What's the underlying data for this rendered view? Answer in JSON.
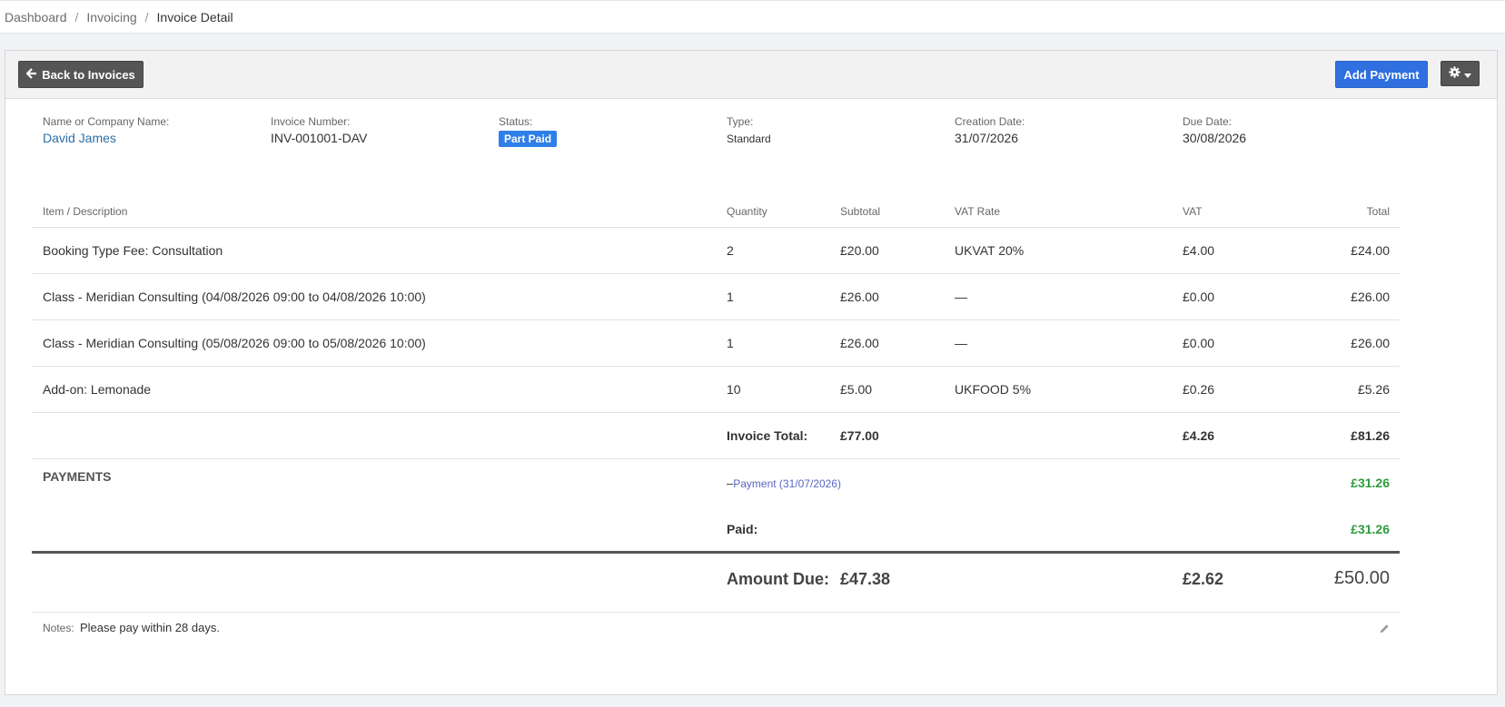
{
  "breadcrumb": {
    "items": [
      "Dashboard",
      "Invoicing"
    ],
    "current": "Invoice Detail",
    "separator": "/"
  },
  "toolbar": {
    "back_label": "Back to Invoices",
    "add_payment_label": "Add Payment"
  },
  "info": {
    "name_label": "Name or Company Name:",
    "name_value": "David James",
    "number_label": "Invoice Number:",
    "number_value": "INV-001001-DAV",
    "status_label": "Status:",
    "status_value": "Part Paid",
    "type_label": "Type:",
    "type_value": "Standard",
    "creation_label": "Creation Date:",
    "creation_value": "31/07/2026",
    "due_label": "Due Date:",
    "due_value": "30/08/2026"
  },
  "table": {
    "headers": [
      "Item / Description",
      "Quantity",
      "Subtotal",
      "VAT Rate",
      "VAT",
      "Total"
    ],
    "rows": [
      {
        "description": "Booking Type Fee: Consultation",
        "quantity": "2",
        "subtotal": "£20.00",
        "vat_rate": "UKVAT 20%",
        "vat": "£4.00",
        "total": "£24.00"
      },
      {
        "description": "Class - Meridian Consulting (04/08/2026 09:00 to 04/08/2026 10:00)",
        "quantity": "1",
        "subtotal": "£26.00",
        "vat_rate": "—",
        "vat": "£0.00",
        "total": "£26.00"
      },
      {
        "description": "Class - Meridian Consulting (05/08/2026 09:00 to 05/08/2026 10:00)",
        "quantity": "1",
        "subtotal": "£26.00",
        "vat_rate": "—",
        "vat": "£0.00",
        "total": "£26.00"
      },
      {
        "description": "Add-on: Lemonade",
        "quantity": "10",
        "subtotal": "£5.00",
        "vat_rate": "UKFOOD 5%",
        "vat": "£0.26",
        "total": "£5.26"
      }
    ],
    "invoice_total": {
      "label": "Invoice Total:",
      "subtotal": "£77.00",
      "vat": "£4.26",
      "total": "£81.26"
    }
  },
  "payments": {
    "heading": "PAYMENTS",
    "item_prefix": "–",
    "item_label": "Payment (31/07/2026)",
    "item_amount": "£31.26",
    "paid_label": "Paid:",
    "paid_amount": "£31.26"
  },
  "amount_due": {
    "label": "Amount Due:",
    "subtotal": "£47.38",
    "vat": "£2.62",
    "total": "£50.00"
  },
  "notes": {
    "label": "Notes:",
    "text": "Please pay within 28 days."
  },
  "colors": {
    "accent": "#2f6fe0",
    "status_badge": "#2f7fe8",
    "paid_green": "#2e9c3e",
    "link": "#2a6fa8"
  },
  "icons": {
    "back": "arrow-left-icon",
    "settings": "gear-icon",
    "dropdown": "caret-down-icon",
    "edit": "pencil-icon"
  }
}
